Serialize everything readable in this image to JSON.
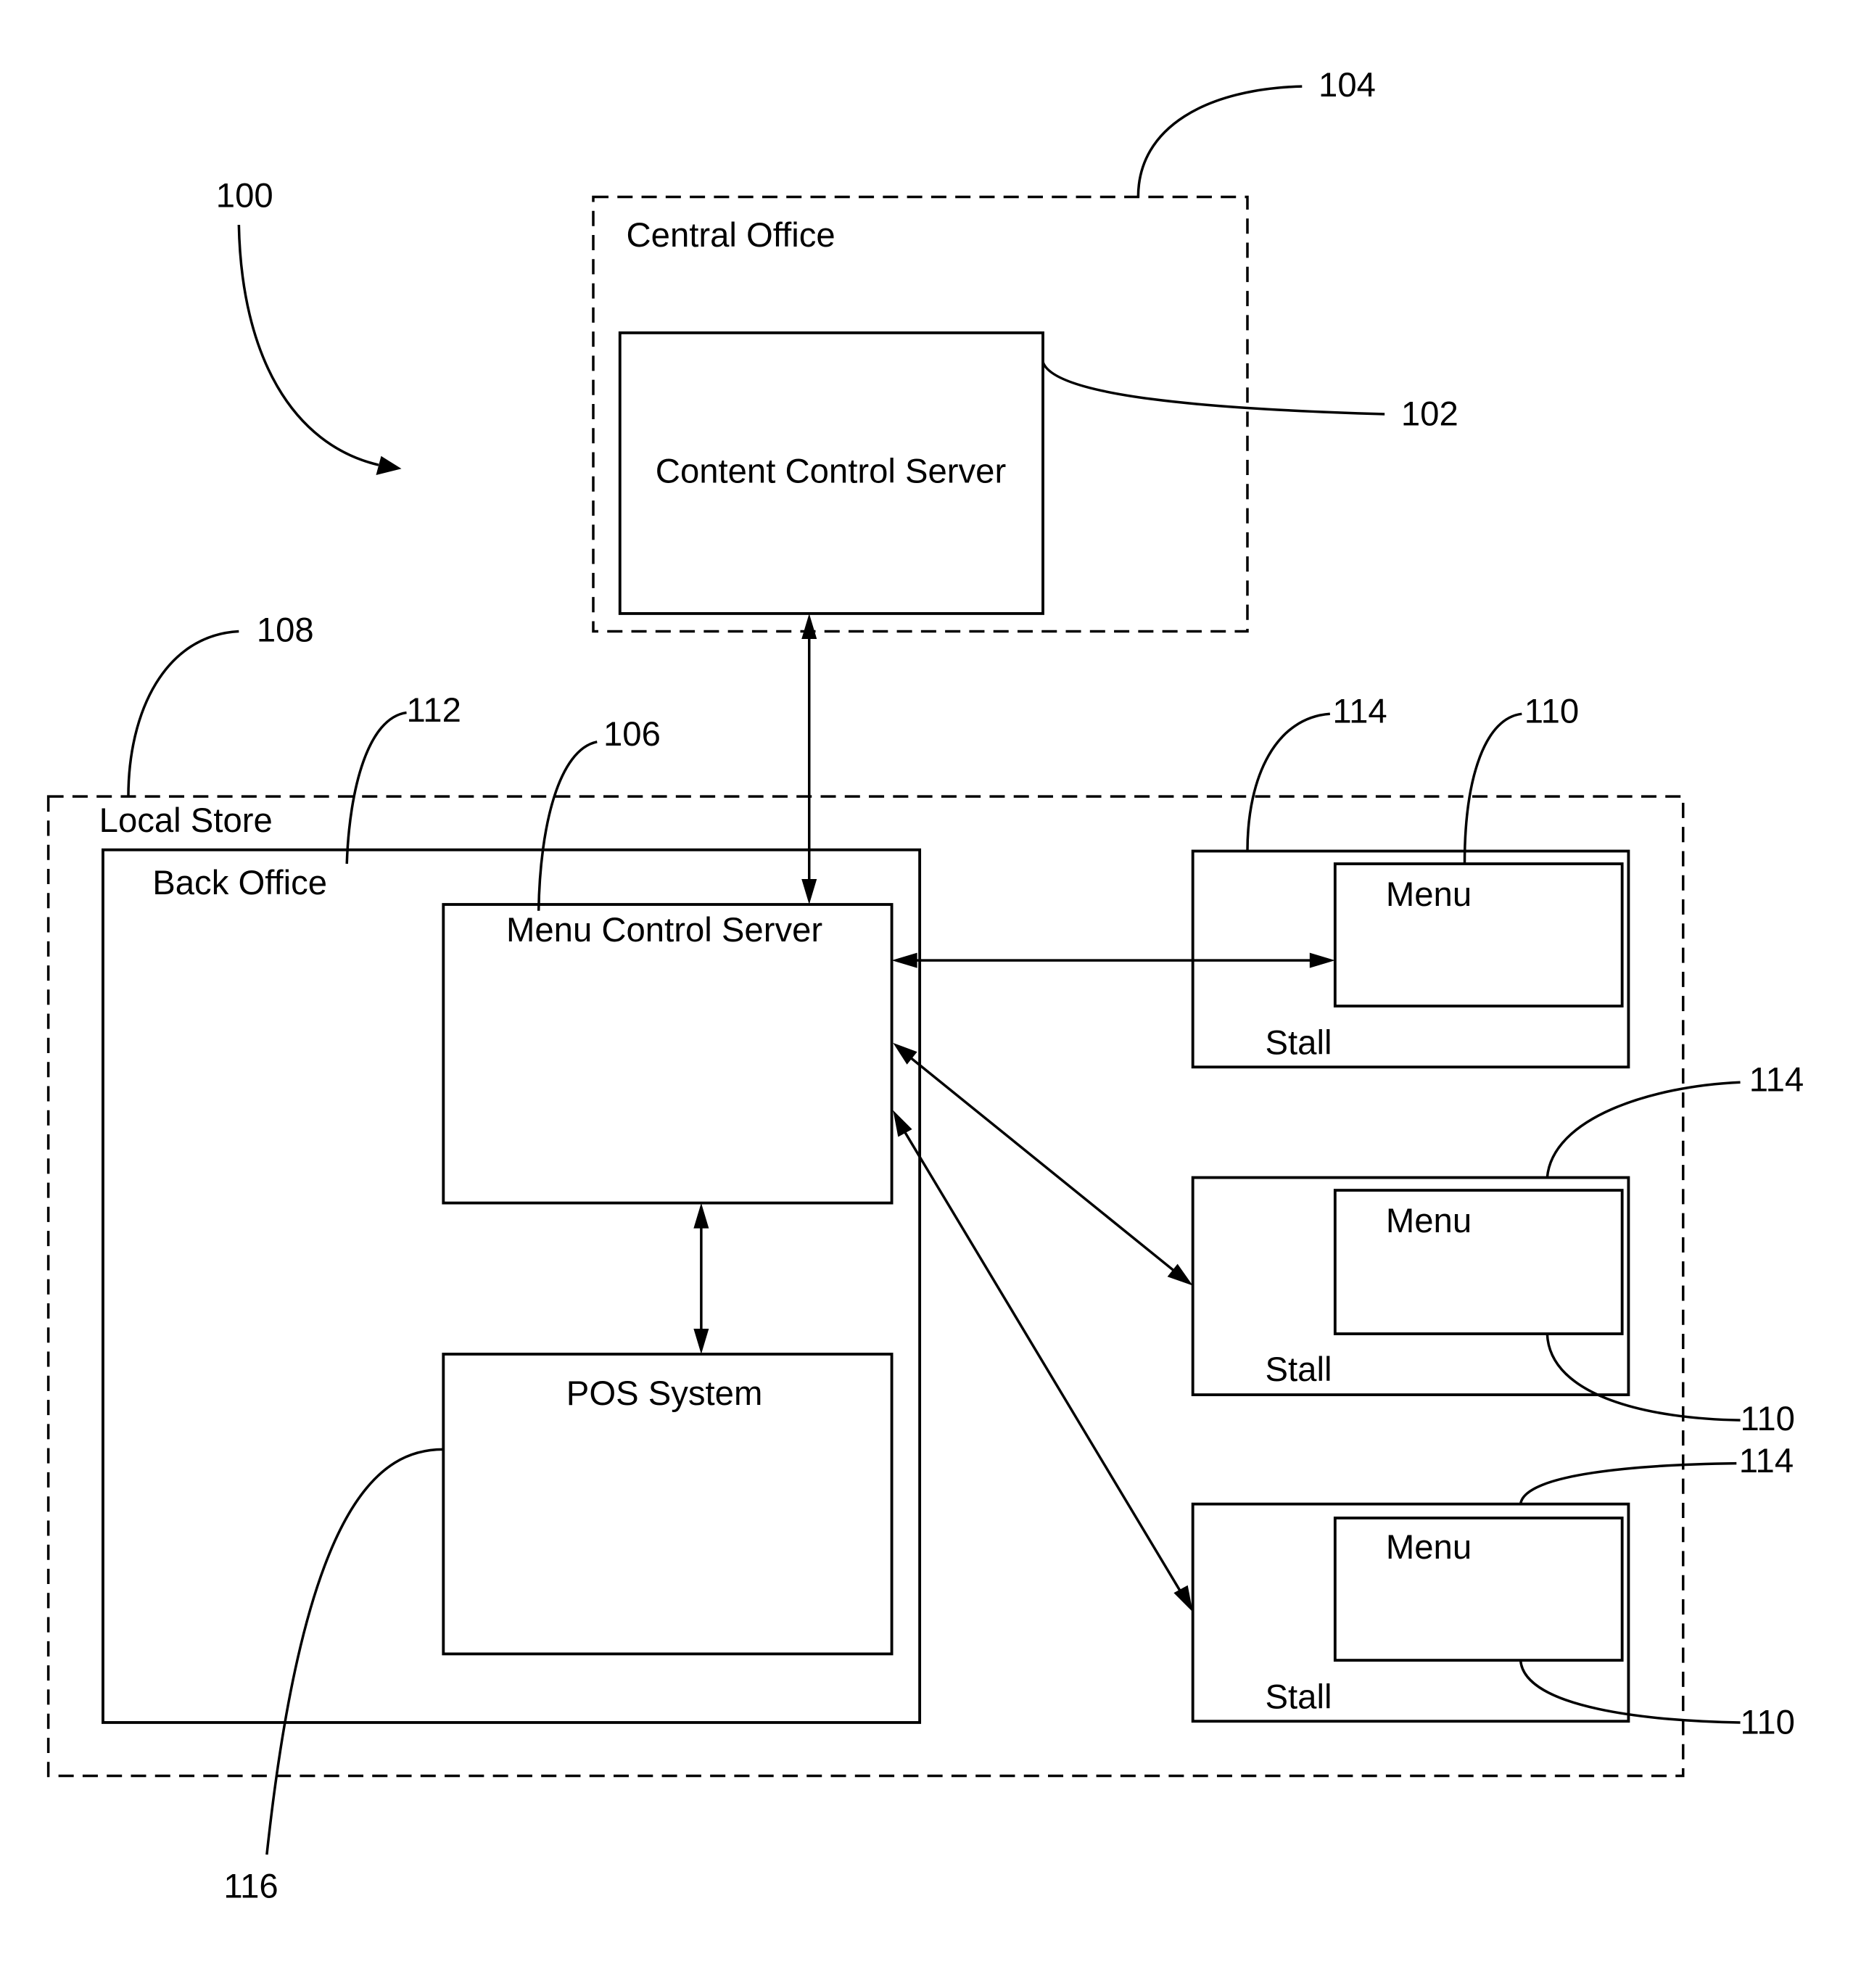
{
  "figure": {
    "system_ref": "100",
    "central_office": {
      "label": "Central Office",
      "ref": "104"
    },
    "content_control_server": {
      "label": "Content Control Server",
      "ref": "102"
    },
    "local_store": {
      "label": "Local Store",
      "ref": "108"
    },
    "back_office": {
      "label": "Back Office",
      "ref": "112"
    },
    "menu_control_server": {
      "label": "Menu Control Server",
      "ref": "106"
    },
    "pos_system": {
      "label": "POS System",
      "ref": "116"
    },
    "stalls": [
      {
        "label": "Stall",
        "ref": "114",
        "menu": {
          "label": "Menu",
          "ref": "110"
        }
      },
      {
        "label": "Stall",
        "ref": "114",
        "menu": {
          "label": "Menu",
          "ref": "110"
        }
      },
      {
        "label": "Stall",
        "ref": "114",
        "menu": {
          "label": "Menu",
          "ref": "110"
        }
      }
    ]
  }
}
